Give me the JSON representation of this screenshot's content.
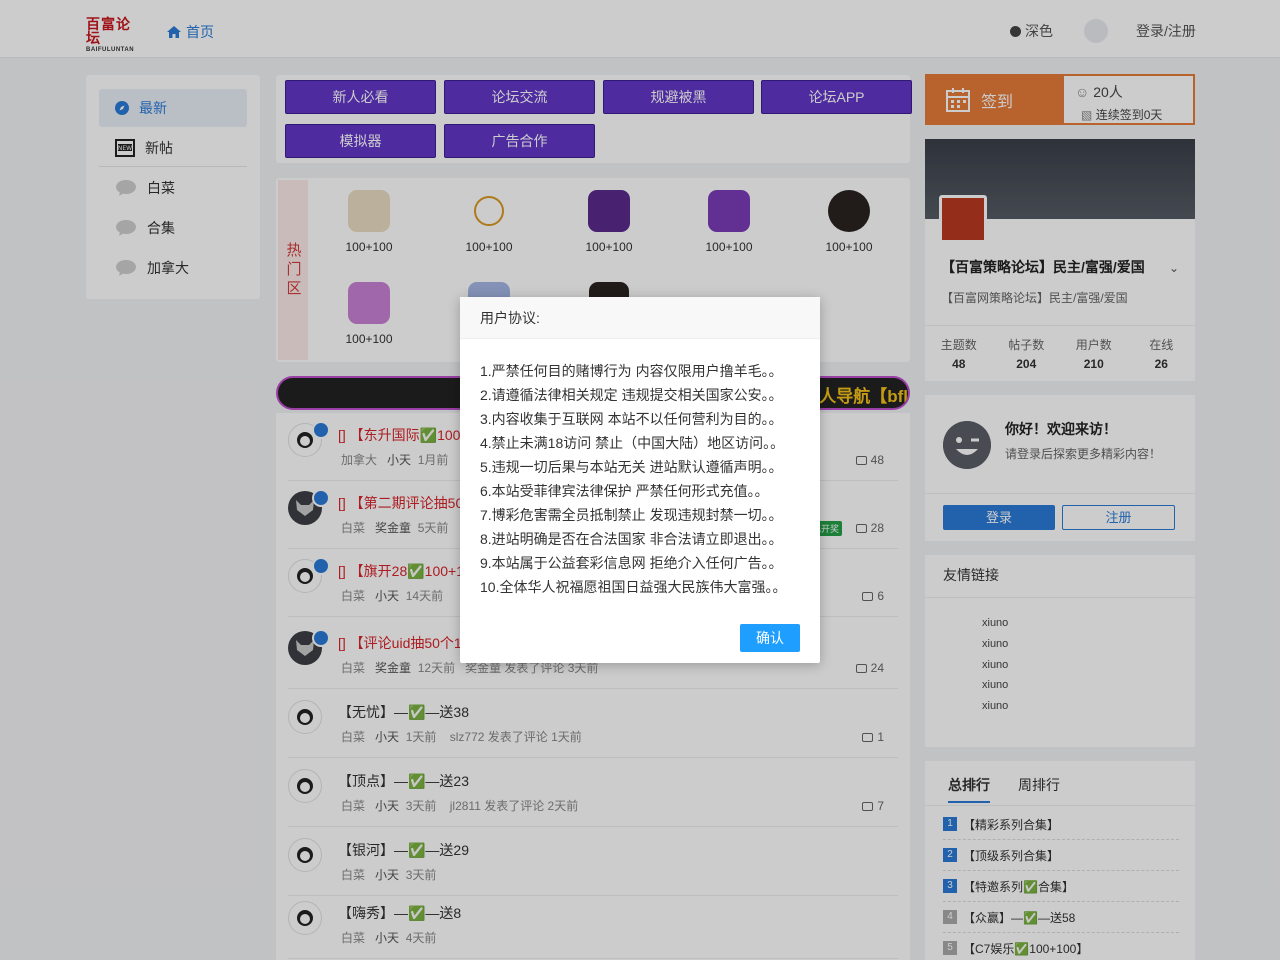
{
  "header": {
    "logo_cn": "百富论坛",
    "logo_en": "BAIFULUNTAN",
    "home": "首页",
    "dark": "深色",
    "login": "登录/注册"
  },
  "left_nav": {
    "items": [
      {
        "label": "最新",
        "icon": "compass-icon"
      },
      {
        "label": "新帖",
        "icon": "new-icon"
      },
      {
        "label": "白菜",
        "icon": "chat-bubble-icon"
      },
      {
        "label": "合集",
        "icon": "chat-bubble-icon"
      },
      {
        "label": "加拿大",
        "icon": "chat-bubble-icon"
      }
    ]
  },
  "tags": [
    "新人必看",
    "论坛交流",
    "规避被黑",
    "论坛APP",
    "模拟器",
    "广告合作"
  ],
  "hot": {
    "label": "热门区",
    "apps": [
      {
        "label": "100+100",
        "color": "#e9dcc2"
      },
      {
        "label": "100+100",
        "color": "#d99a22"
      },
      {
        "label": "100+100",
        "color": "#5b2a8c"
      },
      {
        "label": "100+100",
        "color": "#7b3bb8"
      },
      {
        "label": "100+100",
        "color": "#2a2420"
      },
      {
        "label": "100+100",
        "color": "#c882d6"
      }
    ]
  },
  "marquee": "人导航【bfl",
  "posts": [
    {
      "title": "[] 【东升国际✅100",
      "red": true,
      "meta": "加拿大",
      "author": "小天",
      "time": "1月前",
      "count": "48",
      "pinned": true
    },
    {
      "title": "[] 【第二期评论抽50",
      "red": true,
      "meta": "白菜",
      "author": "奖金童",
      "time": "5天前",
      "count": "28",
      "pinned": true,
      "badge": "已开奖"
    },
    {
      "title": "[] 【旗开28✅100+1",
      "red": true,
      "meta": "白菜",
      "author": "小天",
      "time": "14天前",
      "count": "6",
      "pinned": true
    },
    {
      "title": "[] 【评论uid抽50个1",
      "red": true,
      "meta": "白菜",
      "author": "奖金童",
      "time": "12天前",
      "count": "24",
      "pinned": true,
      "extra": "奖金童  发表了评论 3天前"
    },
    {
      "title": "【无忧】—✅—送38",
      "red": false,
      "meta": "白菜",
      "author": "小天",
      "time": "1天前",
      "count": "1",
      "extra": "slz772  发表了评论 1天前"
    },
    {
      "title": "【顶点】—✅—送23",
      "red": false,
      "meta": "白菜",
      "author": "小天",
      "time": "3天前",
      "count": "7",
      "extra": "jl2811  发表了评论 2天前"
    },
    {
      "title": "【银河】—✅—送29",
      "red": false,
      "meta": "白菜",
      "author": "小天",
      "time": "3天前"
    },
    {
      "title": "【嗨秀】—✅—送8",
      "red": false,
      "meta": "白菜",
      "author": "小天",
      "time": "4天前"
    }
  ],
  "sign": {
    "label": "签到",
    "count": "20人",
    "streak": "连续签到0天"
  },
  "profile": {
    "name": "【百富策略论坛】民主/富强/爱国",
    "desc": "【百富网策略论坛】民主/富强/爱国",
    "stats": [
      {
        "label": "主题数",
        "value": "48"
      },
      {
        "label": "帖子数",
        "value": "204"
      },
      {
        "label": "用户数",
        "value": "210"
      },
      {
        "label": "在线",
        "value": "26"
      }
    ]
  },
  "welcome": {
    "title": "你好！欢迎来访！",
    "sub": "请登录后探索更多精彩内容！",
    "login": "登录",
    "register": "注册"
  },
  "links": {
    "title": "友情链接",
    "items": [
      "xiuno",
      "xiuno",
      "xiuno",
      "xiuno",
      "xiuno"
    ]
  },
  "rank": {
    "tabs": [
      "总排行",
      "周排行"
    ],
    "rows": [
      {
        "num": "1",
        "label": "【精彩系列合集】",
        "color": "#2b7bd8"
      },
      {
        "num": "2",
        "label": "【顶级系列合集】",
        "color": "#2b7bd8"
      },
      {
        "num": "3",
        "label": "【特邀系列✅合集】",
        "color": "#2b7bd8"
      },
      {
        "num": "4",
        "label": "【众赢】—✅—送58",
        "color": "#aaaaaa"
      },
      {
        "num": "5",
        "label": "【C7娱乐✅100+100】",
        "color": "#aaaaaa"
      }
    ]
  },
  "modal": {
    "title": "用户协议:",
    "items": [
      "1.严禁任何目的赌博行为 内容仅限用户撸羊毛。。",
      "2.请遵循法律相关规定 违规提交相关国家公安。。",
      "3.内容收集于互联网 本站不以任何营利为目的。。",
      "4.禁止未满18访问 禁止（中国大陆）地区访问。。",
      "5.违规一切后果与本站无关 进站默认遵循声明。。",
      "6.本站受菲律宾法律保护 严禁任何形式充值。。",
      "7.博彩危害需全员抵制禁止 发现违规封禁一切。。",
      "8.进站明确是否在合法国家 非合法请立即退出。。",
      "9.本站属于公益套彩信息网 拒绝介入任何广告。。",
      "10.全体华人祝福愿祖国日益强大民族伟大富强。。"
    ],
    "confirm": "确认"
  }
}
